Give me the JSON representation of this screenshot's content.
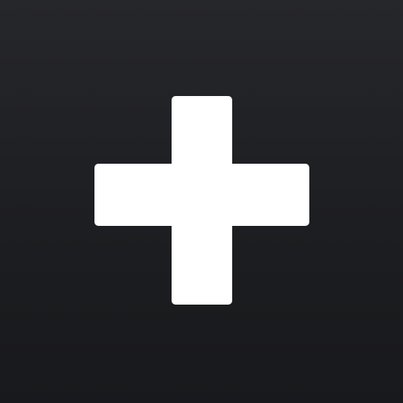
{
  "icon": {
    "name": "plus-icon",
    "background_color": "#1f2024",
    "glyph_color": "#ffffff"
  }
}
